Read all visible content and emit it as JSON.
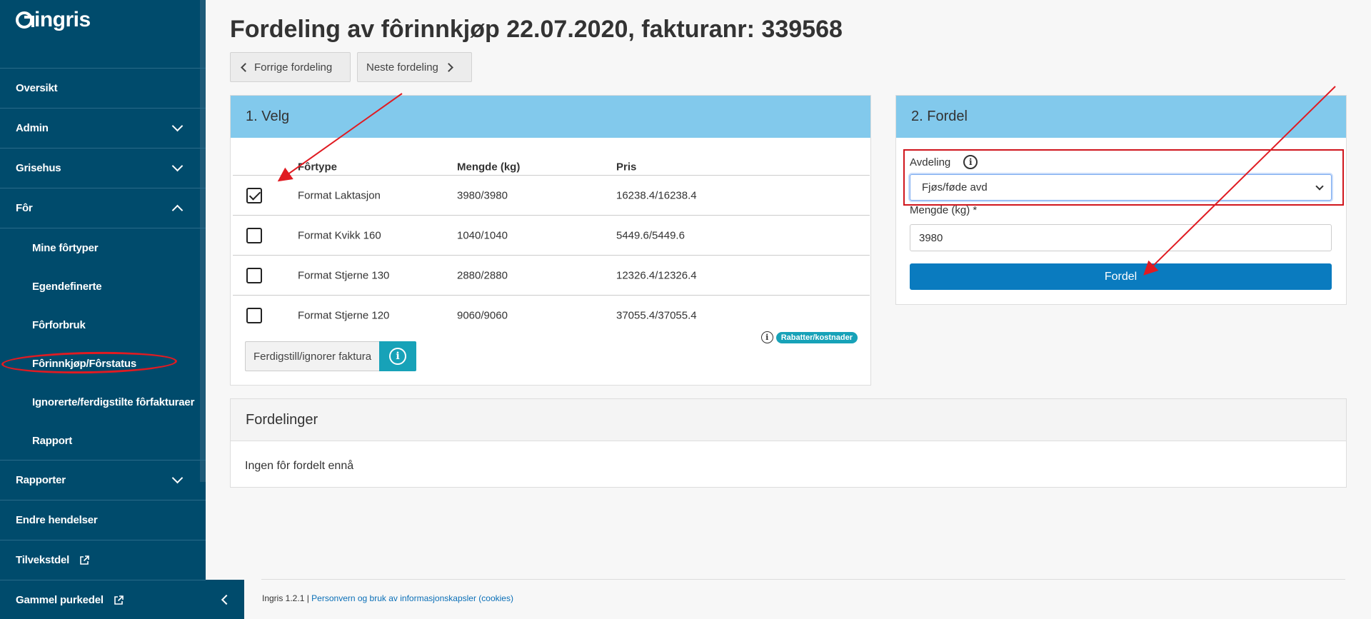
{
  "brand": {
    "logo_text": "ingris"
  },
  "sidebar": {
    "items": [
      {
        "label": "Oversikt"
      },
      {
        "label": "Admin"
      },
      {
        "label": "Grisehus"
      },
      {
        "label": "Fôr"
      },
      {
        "label": "Rapporter"
      },
      {
        "label": "Endre hendelser"
      },
      {
        "label": "Tilvekstdel"
      },
      {
        "label": "Gammel purkedel"
      }
    ],
    "sub_items": [
      {
        "label": "Mine fôrtyper"
      },
      {
        "label": "Egendefinerte"
      },
      {
        "label": "Fôrforbruk"
      },
      {
        "label": "Fôrinnkjøp/Fôrstatus"
      },
      {
        "label": "Ignorerte/ferdigstilte fôrfakturaer"
      },
      {
        "label": "Rapport"
      }
    ]
  },
  "page": {
    "title": "Fordeling av fôrinnkjøp 22.07.2020, fakturanr: 339568",
    "prev_label": "Forrige fordeling",
    "next_label": "Neste fordeling"
  },
  "velg": {
    "header": "1. Velg",
    "columns": [
      "Fôrtype",
      "Mengde (kg)",
      "Pris"
    ],
    "rows": [
      {
        "type": "Format Laktasjon",
        "qty": "3980/3980",
        "price": "16238.4/16238.4",
        "checked": true
      },
      {
        "type": "Format Kvikk 160",
        "qty": "1040/1040",
        "price": "5449.6/5449.6",
        "checked": false
      },
      {
        "type": "Format Stjerne 130",
        "qty": "2880/2880",
        "price": "12326.4/12326.4",
        "checked": false
      },
      {
        "type": "Format Stjerne 120",
        "qty": "9060/9060",
        "price": "37055.4/37055.4",
        "checked": false
      }
    ],
    "badge": "Rabatter/kostnader",
    "ignore_label": "Ferdigstill/ignorer faktura"
  },
  "fordel": {
    "header": "2. Fordel",
    "avdeling_label": "Avdeling",
    "avdeling_value": "Fjøs/føde avd",
    "mengde_label": "Mengde (kg) *",
    "mengde_value": "3980",
    "button_label": "Fordel"
  },
  "fordelinger": {
    "header": "Fordelinger",
    "empty": "Ingen fôr fordelt ennå"
  },
  "footer": {
    "version": "Ingris 1.2.1 |",
    "privacy_link": "Personvern og bruk av informasjonskapsler (cookies)"
  },
  "colors": {
    "sidebar": "#004b6c",
    "card_header": "#82c9ec",
    "primary": "#0a7bbf",
    "info": "#17a2b8",
    "annotation": "#e01b22"
  }
}
